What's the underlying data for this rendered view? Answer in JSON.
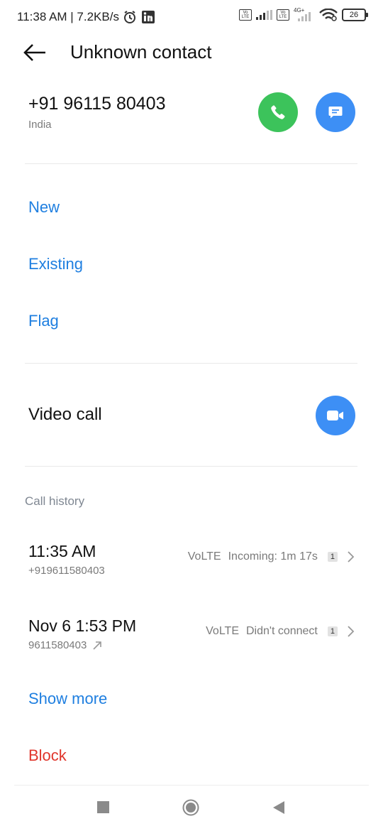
{
  "status_bar": {
    "time_speed": "11:38 AM | 7.2KB/s",
    "sim1_label": "Vo LTE",
    "sim2_label": "Vo LTE",
    "network_type": "4G+",
    "battery": "26",
    "icons": [
      "alarm-icon",
      "linkedin-icon",
      "signal-icon",
      "wifi-icon",
      "battery-icon"
    ]
  },
  "header": {
    "title": "Unknown contact"
  },
  "contact": {
    "phone": "+91 96115 80403",
    "country": "India"
  },
  "actions": {
    "new": "New",
    "existing": "Existing",
    "flag": "Flag"
  },
  "video": {
    "label": "Video call"
  },
  "history": {
    "label": "Call history",
    "entries": [
      {
        "time": "11:35 AM",
        "number": "+919611580403",
        "network": "VoLTE",
        "status": "Incoming: 1m 17s",
        "count": "1"
      },
      {
        "time": "Nov 6 1:53 PM",
        "number": "9611580403",
        "network": "VoLTE",
        "status": "Didn't connect",
        "count": "1"
      }
    ],
    "show_more": "Show more"
  },
  "block": "Block",
  "colors": {
    "accent_blue": "#1f7fe0",
    "call_green": "#3cc35b",
    "button_blue": "#3d8ff5",
    "block_red": "#e0352b"
  }
}
